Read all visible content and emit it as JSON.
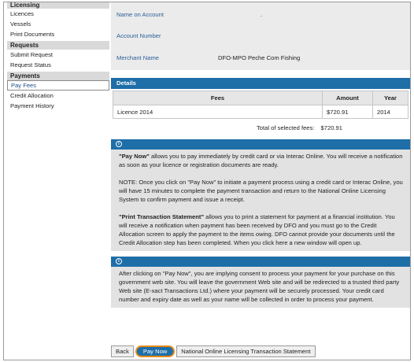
{
  "sidebar": {
    "sections": [
      {
        "title": "Licensing",
        "items": [
          "Licences",
          "Vessels",
          "Print Documents"
        ]
      },
      {
        "title": "Requests",
        "items": [
          "Submit Request",
          "Request Status"
        ]
      },
      {
        "title": "Payments",
        "items": [
          "Pay Fees",
          "Credit Allocation",
          "Payment History"
        ]
      }
    ],
    "active_item": "Pay Fees"
  },
  "account": {
    "name_label": "Name on Account",
    "name_value": ".",
    "number_label": "Account Number",
    "number_value": "",
    "merchant_label": "Merchant Name",
    "merchant_value": "DFO-MPO Peche Com Fishing"
  },
  "details": {
    "heading": "Details",
    "columns": [
      "Fees",
      "Amount",
      "Year"
    ],
    "rows": [
      {
        "fee": "Licence 2014",
        "amount": "$720.91",
        "year": "2014"
      }
    ],
    "total_label": "Total of selected fees:",
    "total_value": "$720.91"
  },
  "info1": {
    "icon": "info-icon",
    "p1_bold": "\"Pay Now\"",
    "p1_rest": " allows you to pay immediately by credit card or via Interac Online. You will receive a notification as soon as your licence or registration documents are ready.",
    "p2": "NOTE: Once you click on \"Pay Now\" to initiate a payment process using a credit card or Interac Online, you will have 15 minutes to complete the payment transaction and return to the National Online Licensing System to confirm payment and issue a receipt.",
    "p3_bold": "\"Print Transaction Statement\"",
    "p3_rest": " allows you to print a statement for payment at a financial institution. You will receive a notification when payment has been received by DFO and you must go to the Credit Allocation screen to apply the payment to the items owing. DFO cannot provide your documents until the Credit Allocation step has been completed. When you click here a new window will open up."
  },
  "info2": {
    "icon": "info-icon",
    "text": "After clicking on \"Pay Now\", you are implying consent to process your payment for your purchase on this government web site. You will leave the government Web site and will be redirected to a trusted third party Web site (E-xact Transactions Ltd.) where your payment will be securely processed. Your credit card number and expiry date as well as your name will be collected in order to process your payment."
  },
  "buttons": {
    "back": "Back",
    "pay_now": "Pay Now",
    "statement": "National Online Licensing Transaction Statement"
  },
  "colors": {
    "accent": "#1e6ea8",
    "highlight": "#e58a1a",
    "panel": "#e2e2e2"
  }
}
